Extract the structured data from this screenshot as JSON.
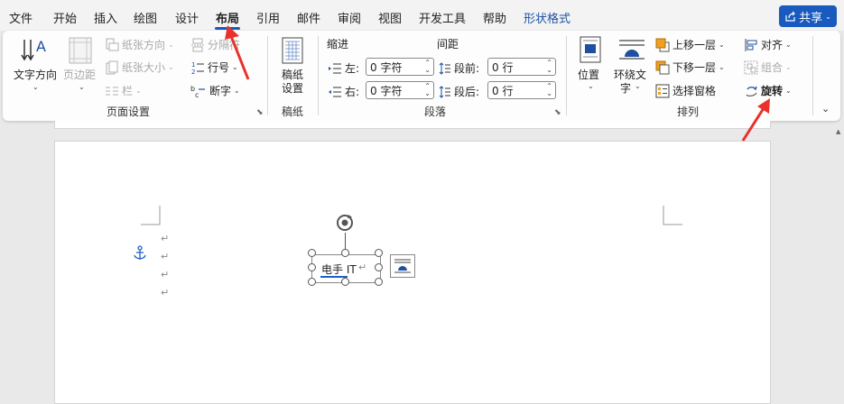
{
  "tabs": [
    "文件",
    "开始",
    "插入",
    "绘图",
    "设计",
    "布局",
    "引用",
    "邮件",
    "审阅",
    "视图",
    "开发工具",
    "帮助",
    "形状格式"
  ],
  "share_label": "共享",
  "page_setup": {
    "text_direction": "文字方向",
    "margins": "页边距",
    "orientation": "纸张方向",
    "size": "纸张大小",
    "columns": "栏",
    "breaks": "分隔符",
    "line_numbers": "行号",
    "hyphenation": "断字",
    "group": "页面设置"
  },
  "draft": {
    "button_line1": "稿纸",
    "button_line2": "设置",
    "group": "稿纸"
  },
  "paragraph": {
    "indent_header": "缩进",
    "spacing_header": "间距",
    "left_label": "左:",
    "right_label": "右:",
    "left_value": "0 字符",
    "right_value": "0 字符",
    "before_label": "段前:",
    "after_label": "段后:",
    "before_value": "0 行",
    "after_value": "0 行",
    "group": "段落"
  },
  "arrange": {
    "position": "位置",
    "wrap_line1": "环绕文",
    "wrap_line2": "字",
    "bring_forward": "上移一层",
    "send_backward": "下移一层",
    "selection_pane": "选择窗格",
    "align": "对齐",
    "group_btn": "组合",
    "rotate": "旋转",
    "group": "排列"
  },
  "document": {
    "textbox_text": "电手 IT"
  },
  "colors": {
    "accent": "#185abd",
    "arrow": "#e8322b"
  }
}
